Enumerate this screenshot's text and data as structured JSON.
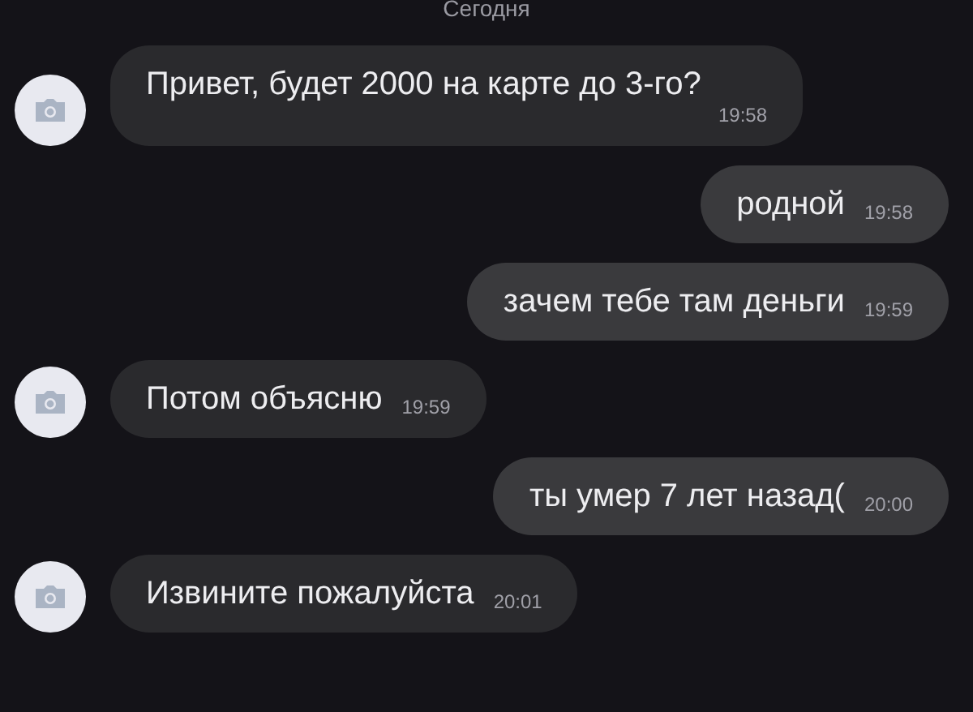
{
  "date_label": "Сегодня",
  "messages": [
    {
      "kind": "incoming",
      "text": "Привет, будет 2000 на карте до 3-го?",
      "time": "19:58"
    },
    {
      "kind": "outgoing",
      "text": "родной",
      "time": "19:58"
    },
    {
      "kind": "outgoing",
      "text": "зачем тебе там деньги",
      "time": "19:59"
    },
    {
      "kind": "incoming",
      "text": "Потом объясню",
      "time": "19:59"
    },
    {
      "kind": "outgoing",
      "text": "ты умер 7 лет назад(",
      "time": "20:00"
    },
    {
      "kind": "incoming",
      "text": "Извините пожалуйста",
      "time": "20:01"
    }
  ]
}
